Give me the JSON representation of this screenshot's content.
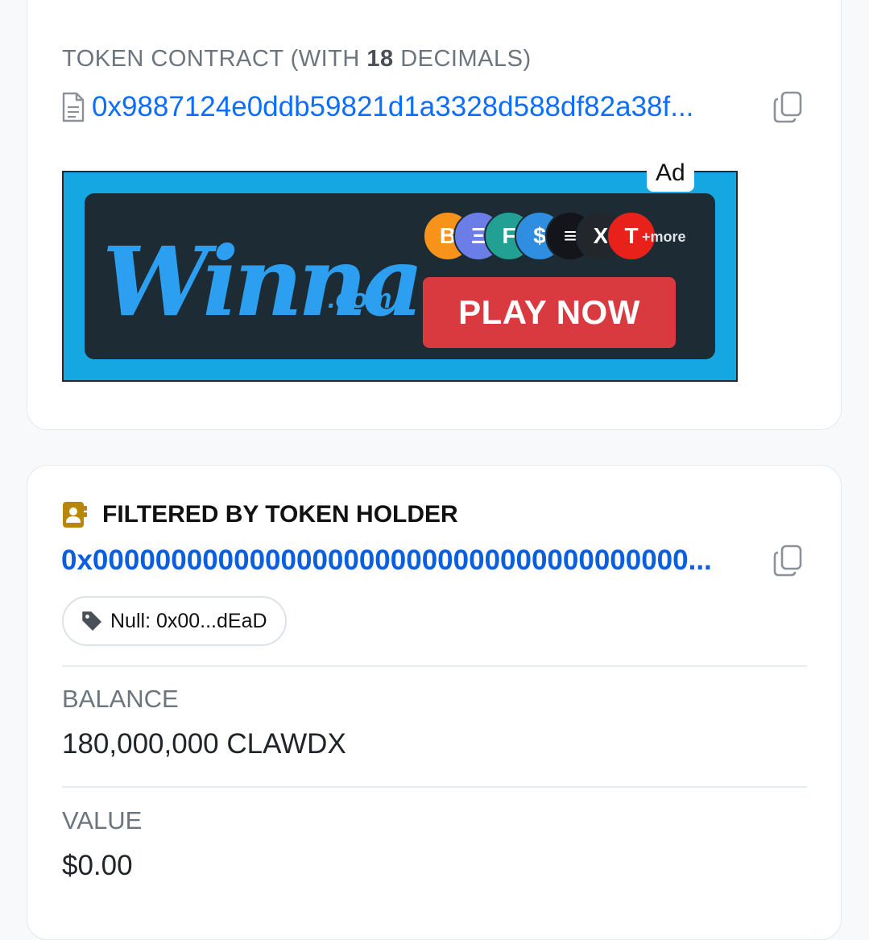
{
  "contract": {
    "label_prefix": "TOKEN CONTRACT (WITH ",
    "decimals": "18",
    "label_suffix": " DECIMALS)",
    "address": "0x9887124e0ddb59821d1a3328d588df82a38f...",
    "icon": "file-icon",
    "copy_icon": "copy-icon"
  },
  "ad": {
    "badge": "Ad",
    "brand": "Winna",
    "brand_suffix": ".com",
    "more": "+more",
    "cta": "PLAY NOW",
    "coins": [
      {
        "symbol": "B",
        "color": "#f7931a"
      },
      {
        "symbol": "Ξ",
        "color": "#6b7ee8"
      },
      {
        "symbol": "F",
        "color": "#23a094"
      },
      {
        "symbol": "$",
        "color": "#2f8ee0"
      },
      {
        "symbol": "≡",
        "color": "#14151a"
      },
      {
        "symbol": "X",
        "color": "#23272b"
      },
      {
        "symbol": "T",
        "color": "#e8221b"
      }
    ],
    "colors": {
      "frame": "#15a7e2",
      "panel": "#1c2b34",
      "cta": "#d83a40"
    }
  },
  "holder": {
    "title": "FILTERED BY TOKEN HOLDER",
    "icon": "address-book-icon",
    "address": "0x00000000000000000000000000000000000000...",
    "tag_icon": "tag-icon",
    "tag": "Null: 0x00...dEaD",
    "balance_label": "BALANCE",
    "balance_value": "180,000,000 CLAWDX",
    "value_label": "VALUE",
    "value_value": "$0.00"
  },
  "colors": {
    "link": "#0d6efd",
    "muted": "#6c757d",
    "badge_icon": "#b8860b"
  }
}
